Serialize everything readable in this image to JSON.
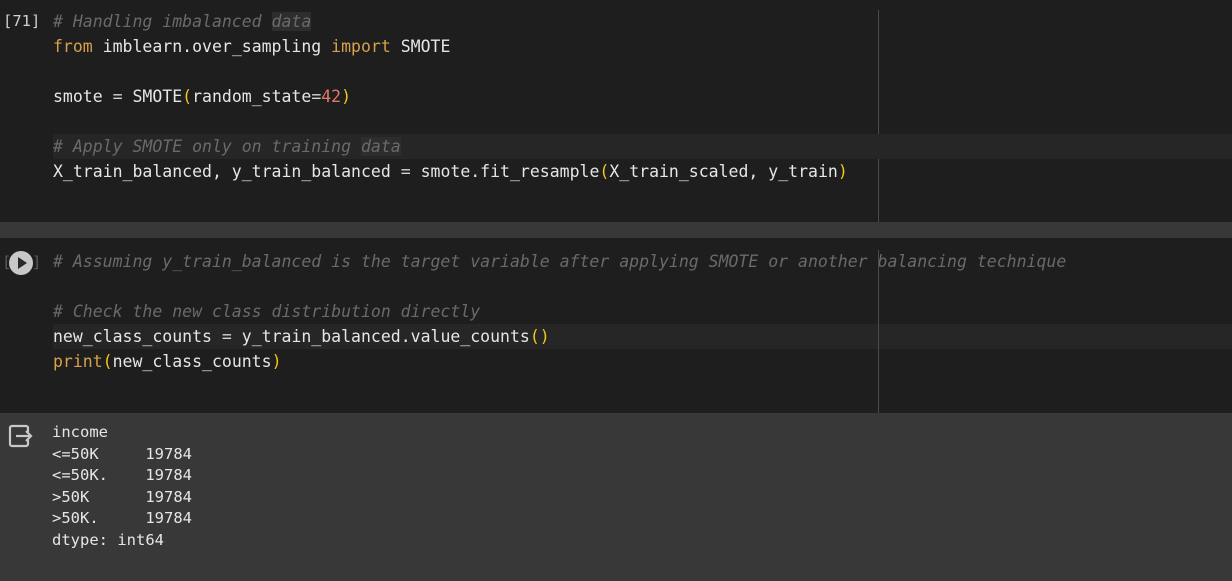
{
  "cell1": {
    "execution_count": "[71]",
    "lines": {
      "l1": {
        "comment_start": "# Handling imbalanced ",
        "comment_end": "data"
      },
      "l2": {
        "from": "from",
        "module": " imblearn.over_sampling ",
        "import": "import",
        "name": " SMOTE"
      },
      "l3": {
        "var": "smote",
        "eq": " = ",
        "cls": "SMOTE",
        "lp": "(",
        "arg": "random_state",
        "eq2": "=",
        "num": "42",
        "rp": ")"
      },
      "l4": {
        "comment_start": "# Apply SMOTE only on training ",
        "comment_end": "data"
      },
      "l5": {
        "lhs": "X_train_balanced, y_train_balanced",
        "eq": " = ",
        "call": "smote.fit_resample",
        "lp": "(",
        "args": "X_train_scaled, y_train",
        "rp": ")"
      }
    }
  },
  "cell2": {
    "lines": {
      "l1": {
        "comment": "# Assuming y_train_balanced is the target variable after applying SMOTE or another balancing technique"
      },
      "l2": {
        "comment": "# Check the new class distribution directly"
      },
      "l3": {
        "var": "new_class_counts",
        "eq": " = ",
        "call": "y_train_balanced.value_counts",
        "parens": "()"
      },
      "l4": {
        "fn": "print",
        "lp": "(",
        "arg": "new_class_counts",
        "rp": ")"
      }
    }
  },
  "output": {
    "lines": [
      "income",
      "<=50K     19784",
      "<=50K.    19784",
      ">50K      19784",
      ">50K.     19784",
      "dtype: int64"
    ]
  },
  "icons": {
    "run": "play-icon",
    "output": "output-exit-icon"
  }
}
